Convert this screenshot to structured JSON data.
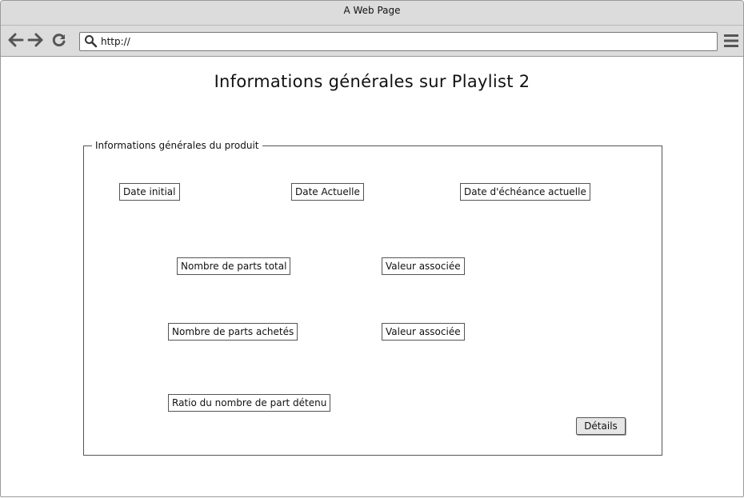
{
  "window": {
    "title": "A Web Page"
  },
  "toolbar": {
    "back_icon": "back-arrow-icon",
    "forward_icon": "forward-arrow-icon",
    "reload_icon": "reload-icon",
    "url": "http://",
    "menu_icon": "hamburger-menu-icon"
  },
  "page": {
    "title": "Informations générales sur Playlist 2"
  },
  "group": {
    "legend": "Informations générales du produit",
    "fields": {
      "date_initial": "Date initial",
      "date_actuelle": "Date Actuelle",
      "date_echeance": "Date d'échéance actuelle",
      "nombre_parts_total": "Nombre de parts total",
      "valeur_associee_1": "Valeur associée",
      "nombre_parts_achetes": "Nombre de parts achetés",
      "valeur_associee_2": "Valeur associée",
      "ratio": "Ratio du nombre de part détenu"
    },
    "details_label": "Détails"
  }
}
